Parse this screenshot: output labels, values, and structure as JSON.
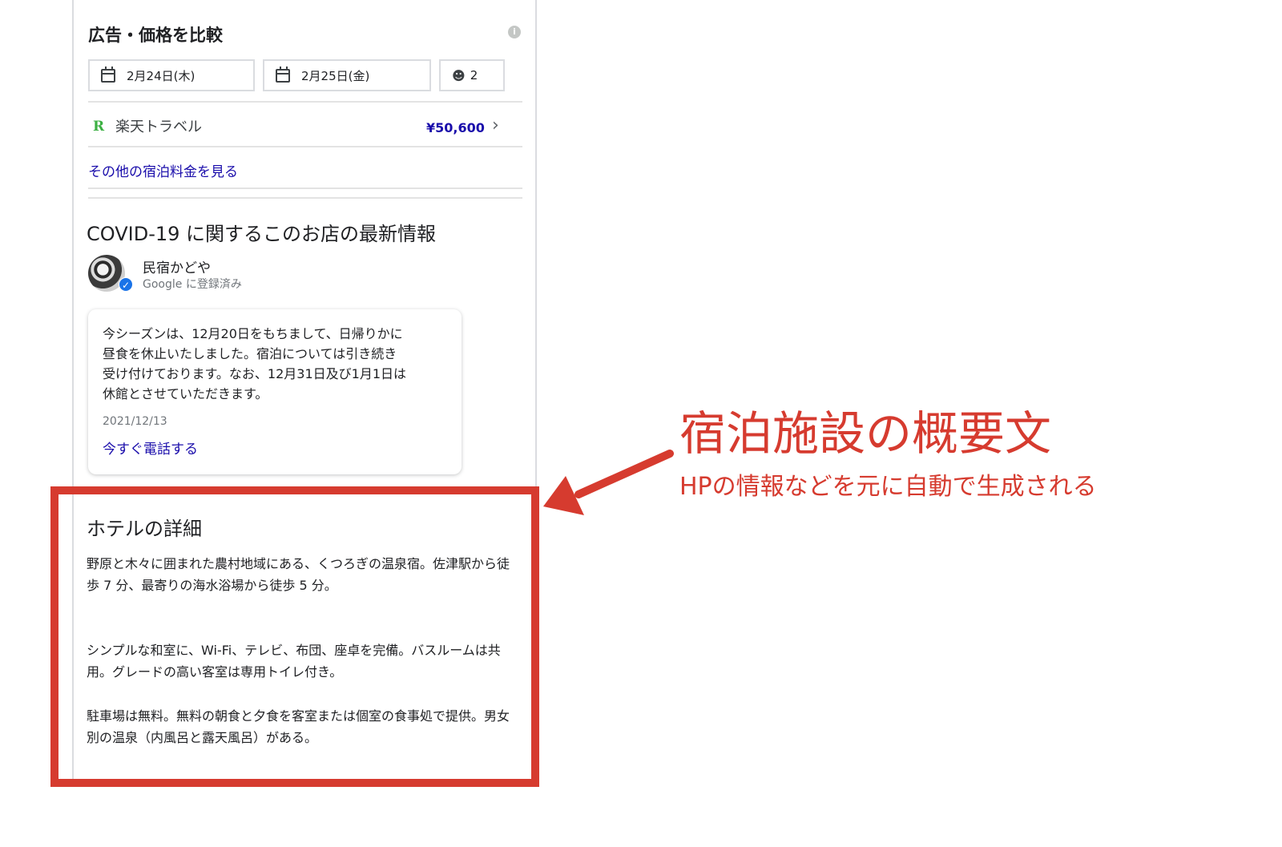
{
  "ad_section": {
    "title": "広告・価格を比較",
    "info_icon": "i",
    "checkin": "2月24日(木)",
    "checkout": "2月25日(金)",
    "guests": "2",
    "provider_icon": "R",
    "provider_name": "楽天トラベル",
    "price": "¥50,600",
    "more_rates": "その他の宿泊料金を見る"
  },
  "covid": {
    "title": "COVID-19 に関するこのお店の最新情報",
    "business_name": "民宿かどや",
    "business_sub": "Google に登録済み",
    "post_lines": [
      "今シーズンは、12月20日をもちまして、日帰りかに",
      "昼食を休止いたしました。宿泊については引き続き",
      "受け付けております。なお、12月31日及び1月1日は",
      "休館とさせていただきます。"
    ],
    "post_date": "2021/12/13",
    "call_link": "今すぐ電話する"
  },
  "details": {
    "title": "ホテルの詳細",
    "paragraphs": [
      "野原と木々に囲まれた農村地域にある、くつろぎの温泉宿。佐津駅から徒歩 7 分、最寄りの海水浴場から徒歩 5 分。",
      "シンプルな和室に、Wi-Fi、テレビ、布団、座卓を完備。バスルームは共用。グレードの高い客室は専用トイレ付き。",
      "駐車場は無料。無料の朝食と夕食を客室または個室の食事処で提供。男女別の温泉（内風呂と露天風呂）がある。"
    ]
  },
  "annotation": {
    "title": "宿泊施設の概要文",
    "subtitle": "HPの情報などを元に自動で生成される",
    "color": "#d63b2f"
  },
  "icons": {
    "calendar": "calendar-icon",
    "person": "person-icon",
    "verified": "verified-check-icon",
    "chevron": "chevron-right-icon"
  }
}
